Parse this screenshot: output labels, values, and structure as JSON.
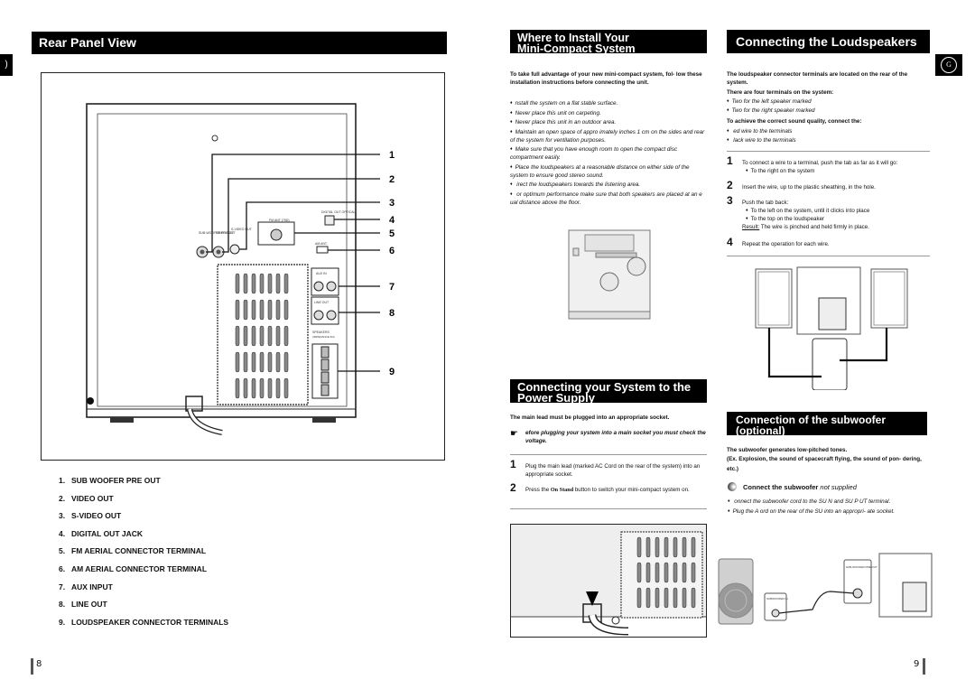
{
  "left_page": {
    "side_tab_glyph": ")",
    "title": "Rear Panel View",
    "figure": {
      "callouts": [
        "1",
        "2",
        "3",
        "4",
        "5",
        "6",
        "7",
        "8",
        "9"
      ],
      "panel_labels": {
        "subwoofer": "SUB-WOOFER PRE OUT",
        "video": "VIDEO OUT",
        "svideo": "S-VIDEO OUT",
        "fm": "FM ANT (75Ω)",
        "digital": "DIGITAL OUT OPTICAL",
        "am": "AM ANT.",
        "aux": "AUX IN",
        "lineout": "LINE OUT",
        "speakers": "SPEAKERS",
        "impedance": "(IMPEDANCE 6Ω)"
      }
    },
    "legend": [
      {
        "num": "1.",
        "label": "SUB WOOFER PRE OUT"
      },
      {
        "num": "2.",
        "label": "VIDEO OUT"
      },
      {
        "num": "3.",
        "label": "S-VIDEO OUT"
      },
      {
        "num": "4.",
        "label": "DIGITAL OUT JACK"
      },
      {
        "num": "5.",
        "label": "FM AERIAL CONNECTOR TERMINAL"
      },
      {
        "num": "6.",
        "label": "AM AERIAL CONNECTOR TERMINAL"
      },
      {
        "num": "7.",
        "label": "AUX INPUT"
      },
      {
        "num": "8.",
        "label": "LINE OUT"
      },
      {
        "num": "9.",
        "label": "LOUDSPEAKER CONNECTOR TERMINALS"
      }
    ],
    "page_number": "8"
  },
  "install": {
    "title_line1": "Where to Install Your",
    "title_line2": "Mini-Compact System",
    "intro": "To take full advantage of your new mini-compact system, fol- low these installation instructions before connecting the unit.",
    "bullets": [
      "nstall the system on a flat  stable surface.",
      "Never place this unit on carpeting.",
      "Never place this unit in an outdoor area.",
      "Maintain an open space of appro  imately    inches  1   cm  on the sides and rear of the system  for ventilation purposes.",
      "Make sure that you have enough room to open the compact disc compartment easily.",
      "Place the loudspeakers at a reasonable distance on either side of the system to ensure good stereo sound.",
      "  irect the loudspeakers towards the listening area.",
      "  or optimum performance  make sure that both speakers are placed at an e  ual distance above the floor."
    ]
  },
  "power": {
    "title_line1": "Connecting your System to the",
    "title_line2": "Power Supply",
    "intro": "The main lead must be plugged into an appropriate socket.",
    "note_icon": "pointing-hand-icon",
    "note": "  efore plugging your system into a main socket  you must check the voltage.",
    "steps": [
      {
        "num": "1",
        "text": "Plug the main lead (marked AC Cord on the rear of the system) into an appropriate socket."
      },
      {
        "num": "2",
        "text_pre": "Press the ",
        "text_bold": "On Stand",
        "text_post": "      button to switch your mini-compact system on."
      }
    ]
  },
  "speakers": {
    "title": "Connecting the Loudspeakers",
    "badge": "G",
    "intro": "The loudspeaker connector terminals are located on the rear of the system.",
    "four_terminals": "There are four terminals on the system:",
    "terminal_bullets": [
      "Two for the left speaker  marked",
      "Two for the right speaker  marked"
    ],
    "achieve": "To achieve the correct sound quality, connect the:",
    "wire_bullets": [
      "  ed wire to the    terminals",
      "  lack wire to the    terminals"
    ],
    "steps": [
      {
        "num": "1",
        "text": "To connect a wire to a terminal, push the tab as far as it will go:",
        "sub": [
          "To the right on the system"
        ]
      },
      {
        "num": "2",
        "text": "Insert the wire, up to the plastic sheathing, in the hole.",
        "sub": []
      },
      {
        "num": "3",
        "text": "Push the tab back:",
        "sub": [
          "To the left on the system, until it clicks into place",
          "To the top on the loudspeaker"
        ],
        "result_label": "Result:",
        "result": " The wire is pinched and held firmly in place."
      },
      {
        "num": "4",
        "text": "Repeat the operation for each wire.",
        "sub": []
      }
    ]
  },
  "subwoofer": {
    "title_line1": "Connection of the subwoofer",
    "title_line2": "(optional)",
    "intro1": "The subwoofer generates low-pitched tones.",
    "intro2": "(Ex. Explosion, the sound of spacecraft flying, the sound of pon- dering, etc.)",
    "step_heading": "Connect the subwoofer",
    "step_heading_note": "  not supplied",
    "bullets": [
      "  onnect the subwoofer cord to the SU                N and SU              P      UT terminal.",
      "Plug the A     ord on the rear of the SU                into an appropri- ate socket."
    ],
    "fig_labels": {
      "sub_pre_out": "SUB-WOOFER PRE OUT",
      "sub_in": "SUBWOOFER IN"
    },
    "page_number": "9"
  }
}
